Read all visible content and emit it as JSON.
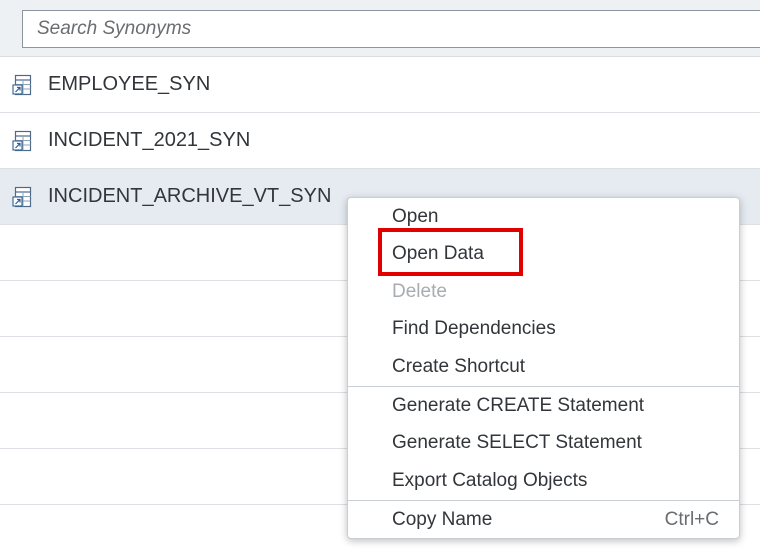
{
  "search": {
    "placeholder": "Search Synonyms",
    "value": ""
  },
  "rows": [
    {
      "label": "EMPLOYEE_SYN",
      "icon": "synonym-table-icon",
      "selected": false
    },
    {
      "label": "INCIDENT_2021_SYN",
      "icon": "synonym-table-icon",
      "selected": false
    },
    {
      "label": "INCIDENT_ARCHIVE_VT_SYN",
      "icon": "synonym-table-icon",
      "selected": true
    }
  ],
  "context_menu": {
    "items": [
      {
        "label": "Open",
        "enabled": true
      },
      {
        "label": "Open Data",
        "enabled": true,
        "highlighted": true
      },
      {
        "label": "Delete",
        "enabled": false
      },
      {
        "label": "Find Dependencies",
        "enabled": true
      },
      {
        "label": "Create Shortcut",
        "enabled": true
      },
      {
        "label": "Generate CREATE Statement",
        "enabled": true
      },
      {
        "label": "Generate SELECT Statement",
        "enabled": true
      },
      {
        "label": "Export Catalog Objects",
        "enabled": true
      },
      {
        "label": "Copy Name",
        "enabled": true,
        "shortcut": "Ctrl+C"
      }
    ]
  },
  "colors": {
    "highlight_border": "#e00000",
    "selected_row": "#e5ebf1",
    "disabled_text": "#a7acb1"
  }
}
